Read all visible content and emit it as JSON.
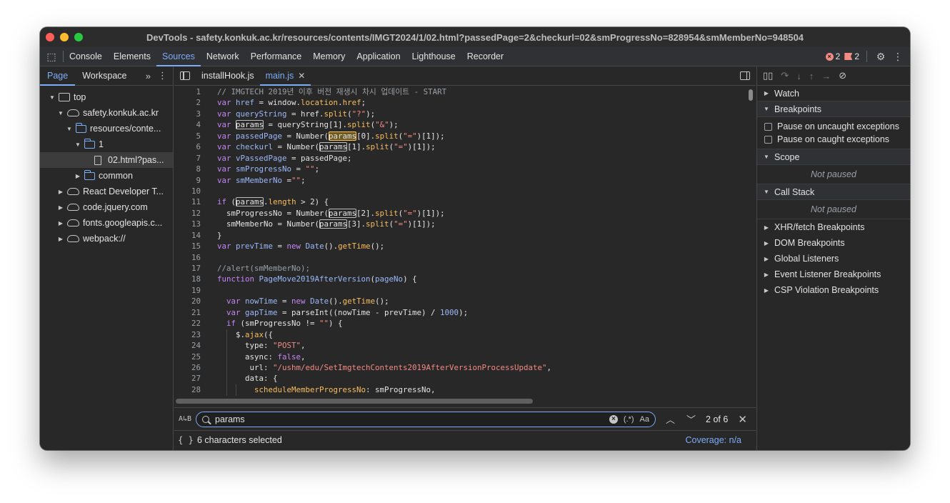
{
  "window": {
    "title": "DevTools - safety.konkuk.ac.kr/resources/contents/IMGT2024/1/02.html?passedPage=2&checkurl=02&smProgressNo=828954&smMemberNo=948504"
  },
  "toolbar": {
    "tabs": [
      "Console",
      "Elements",
      "Sources",
      "Network",
      "Performance",
      "Memory",
      "Application",
      "Lighthouse",
      "Recorder"
    ],
    "active_tab": "Sources",
    "error_count": "2",
    "issue_count": "2"
  },
  "navigator": {
    "tabs": [
      "Page",
      "Workspace"
    ],
    "more": "»",
    "tree": [
      {
        "label": "top",
        "icon": "frame-icon",
        "depth": 0,
        "arrow": "▼"
      },
      {
        "label": "safety.konkuk.ac.kr",
        "icon": "cloud-icon",
        "depth": 1,
        "arrow": "▼"
      },
      {
        "label": "resources/conte...",
        "icon": "folder-icon",
        "depth": 2,
        "arrow": "▼"
      },
      {
        "label": "1",
        "icon": "folder-icon",
        "depth": 3,
        "arrow": "▼"
      },
      {
        "label": "02.html?pas...",
        "icon": "file-icon",
        "depth": 4,
        "arrow": ""
      },
      {
        "label": "common",
        "icon": "folder-icon",
        "depth": 3,
        "arrow": "▶"
      },
      {
        "label": "React Developer T...",
        "icon": "cloud-icon",
        "depth": 1,
        "arrow": "▶"
      },
      {
        "label": "code.jquery.com",
        "icon": "cloud-icon",
        "depth": 1,
        "arrow": "▶"
      },
      {
        "label": "fonts.googleapis.c...",
        "icon": "cloud-icon",
        "depth": 1,
        "arrow": "▶"
      },
      {
        "label": "webpack://",
        "icon": "cloud-icon",
        "depth": 1,
        "arrow": "▶"
      }
    ]
  },
  "editor": {
    "tabs": [
      {
        "label": "installHook.js",
        "active": false
      },
      {
        "label": "main.js",
        "active": true
      }
    ],
    "lines": [
      {
        "n": "1",
        "t": [
          [
            "cm",
            "// IMGTECH 2019년 이후 버전 재생시 차시 업데이트 - START"
          ]
        ]
      },
      {
        "n": "2",
        "t": [
          [
            "kw",
            "var "
          ],
          [
            "vn",
            "href"
          ],
          [
            "",
            " = window."
          ],
          [
            "pr",
            "location"
          ],
          [
            "",
            "."
          ],
          [
            "pr",
            "href"
          ],
          [
            "",
            ";"
          ]
        ]
      },
      {
        "n": "3",
        "t": [
          [
            "kw",
            "var "
          ],
          [
            "vn",
            "queryString"
          ],
          [
            "",
            " = href."
          ],
          [
            "pr",
            "split"
          ],
          [
            "",
            "("
          ],
          [
            "st",
            "\"?\""
          ],
          [
            "",
            ");"
          ]
        ]
      },
      {
        "n": "4",
        "t": [
          [
            "kw",
            "var "
          ],
          [
            "mk",
            "params"
          ],
          [
            "",
            " = queryString[1]."
          ],
          [
            "pr",
            "split"
          ],
          [
            "",
            "("
          ],
          [
            "st",
            "\"&\""
          ],
          [
            "",
            ");"
          ]
        ]
      },
      {
        "n": "5",
        "t": [
          [
            "kw",
            "var "
          ],
          [
            "vn",
            "passedPage"
          ],
          [
            "",
            " = Number("
          ],
          [
            "mkc",
            "params"
          ],
          [
            "",
            "[0]."
          ],
          [
            "pr",
            "split"
          ],
          [
            "",
            "("
          ],
          [
            "st",
            "\"=\""
          ],
          [
            "",
            ")[1]);"
          ]
        ]
      },
      {
        "n": "6",
        "t": [
          [
            "kw",
            "var "
          ],
          [
            "vn",
            "checkurl"
          ],
          [
            "",
            " = Number("
          ],
          [
            "mk",
            "params"
          ],
          [
            "",
            "[1]."
          ],
          [
            "pr",
            "split"
          ],
          [
            "",
            "("
          ],
          [
            "st",
            "\"=\""
          ],
          [
            "",
            ")[1]);"
          ]
        ]
      },
      {
        "n": "7",
        "t": [
          [
            "kw",
            "var "
          ],
          [
            "vn",
            "vPassedPage"
          ],
          [
            "",
            " = passedPage;"
          ]
        ]
      },
      {
        "n": "8",
        "t": [
          [
            "kw",
            "var "
          ],
          [
            "vn",
            "smProgressNo"
          ],
          [
            "",
            " = "
          ],
          [
            "st",
            "\"\""
          ],
          [
            "",
            ";"
          ]
        ]
      },
      {
        "n": "9",
        "t": [
          [
            "kw",
            "var "
          ],
          [
            "vn",
            "smMemberNo"
          ],
          [
            "",
            " ="
          ],
          [
            "st",
            "\"\""
          ],
          [
            "",
            ";"
          ]
        ]
      },
      {
        "n": "10",
        "t": [
          [
            "",
            ""
          ]
        ]
      },
      {
        "n": "11",
        "t": [
          [
            "kw",
            "if "
          ],
          [
            "",
            "("
          ],
          [
            "mk",
            "params"
          ],
          [
            "",
            "."
          ],
          [
            "pr",
            "length"
          ],
          [
            "",
            " > 2) {"
          ]
        ]
      },
      {
        "n": "12",
        "t": [
          [
            "",
            "  smProgressNo = Number("
          ],
          [
            "mk",
            "params"
          ],
          [
            "",
            "[2]."
          ],
          [
            "pr",
            "split"
          ],
          [
            "",
            "("
          ],
          [
            "st",
            "\"=\""
          ],
          [
            "",
            ")[1]);"
          ]
        ]
      },
      {
        "n": "13",
        "t": [
          [
            "",
            "  smMemberNo = Number("
          ],
          [
            "mk",
            "params"
          ],
          [
            "",
            "[3]."
          ],
          [
            "pr",
            "split"
          ],
          [
            "",
            "("
          ],
          [
            "st",
            "\"=\""
          ],
          [
            "",
            ")[1]);"
          ]
        ]
      },
      {
        "n": "14",
        "t": [
          [
            "",
            "}"
          ]
        ]
      },
      {
        "n": "15",
        "t": [
          [
            "kw",
            "var "
          ],
          [
            "vn",
            "prevTime"
          ],
          [
            "",
            " = "
          ],
          [
            "kw",
            "new "
          ],
          [
            "fn",
            "Date"
          ],
          [
            "",
            "()."
          ],
          [
            "pr",
            "getTime"
          ],
          [
            "",
            "();"
          ]
        ]
      },
      {
        "n": "16",
        "t": [
          [
            "",
            ""
          ]
        ]
      },
      {
        "n": "17",
        "t": [
          [
            "cm",
            "//alert(smMemberNo);"
          ]
        ]
      },
      {
        "n": "18",
        "t": [
          [
            "kw",
            "function "
          ],
          [
            "fn",
            "PageMove2019AfterVersion"
          ],
          [
            "",
            "("
          ],
          [
            "vn",
            "pageNo"
          ],
          [
            "",
            ") {"
          ]
        ]
      },
      {
        "n": "19",
        "t": [
          [
            "",
            ""
          ]
        ]
      },
      {
        "n": "20",
        "t": [
          [
            "kw",
            "  var "
          ],
          [
            "vn",
            "nowTime"
          ],
          [
            "",
            " = "
          ],
          [
            "kw",
            "new "
          ],
          [
            "fn",
            "Date"
          ],
          [
            "",
            "()."
          ],
          [
            "pr",
            "getTime"
          ],
          [
            "",
            "();"
          ]
        ]
      },
      {
        "n": "21",
        "t": [
          [
            "kw",
            "  var "
          ],
          [
            "vn",
            "gapTime"
          ],
          [
            "",
            " = parseInt((nowTime - prevTime) / "
          ],
          [
            "nm",
            "1000"
          ],
          [
            "",
            ");"
          ]
        ]
      },
      {
        "n": "22",
        "t": [
          [
            "kw",
            "  if "
          ],
          [
            "",
            "(smProgressNo != "
          ],
          [
            "st",
            "\"\""
          ],
          [
            "",
            ") {"
          ]
        ]
      },
      {
        "n": "23",
        "t": [
          [
            "",
            "    $."
          ],
          [
            "pr",
            "ajax"
          ],
          [
            "",
            "({"
          ]
        ]
      },
      {
        "n": "24",
        "t": [
          [
            "",
            "      type: "
          ],
          [
            "st",
            "\"POST\""
          ],
          [
            "",
            ","
          ]
        ]
      },
      {
        "n": "25",
        "t": [
          [
            "",
            "      async: "
          ],
          [
            "kw",
            "false"
          ],
          [
            "",
            ","
          ]
        ]
      },
      {
        "n": "26",
        "t": [
          [
            "",
            "       url: "
          ],
          [
            "st",
            "\"/ushm/edu/SetImgtechContents2019AfterVersionProcessUpdate\""
          ],
          [
            "",
            ","
          ]
        ]
      },
      {
        "n": "27",
        "t": [
          [
            "",
            "      data: {"
          ]
        ]
      },
      {
        "n": "28",
        "t": [
          [
            "",
            "        "
          ],
          [
            "pr",
            "scheduleMemberProgressNo"
          ],
          [
            "",
            ": smProgressNo,"
          ]
        ]
      }
    ]
  },
  "search": {
    "value": "params",
    "regex_label": "(.*)",
    "case_label": "Aa",
    "match_count": "2 of 6"
  },
  "status": {
    "selection": "6 characters selected",
    "coverage": "Coverage: n/a"
  },
  "debugger": {
    "sections_top": [
      "Watch",
      "Breakpoints"
    ],
    "checkboxes": [
      "Pause on uncaught exceptions",
      "Pause on caught exceptions"
    ],
    "scope": "Scope",
    "scope_empty": "Not paused",
    "call_stack": "Call Stack",
    "call_stack_empty": "Not paused",
    "sections_bottom": [
      "XHR/fetch Breakpoints",
      "DOM Breakpoints",
      "Global Listeners",
      "Event Listener Breakpoints",
      "CSP Violation Breakpoints"
    ]
  }
}
